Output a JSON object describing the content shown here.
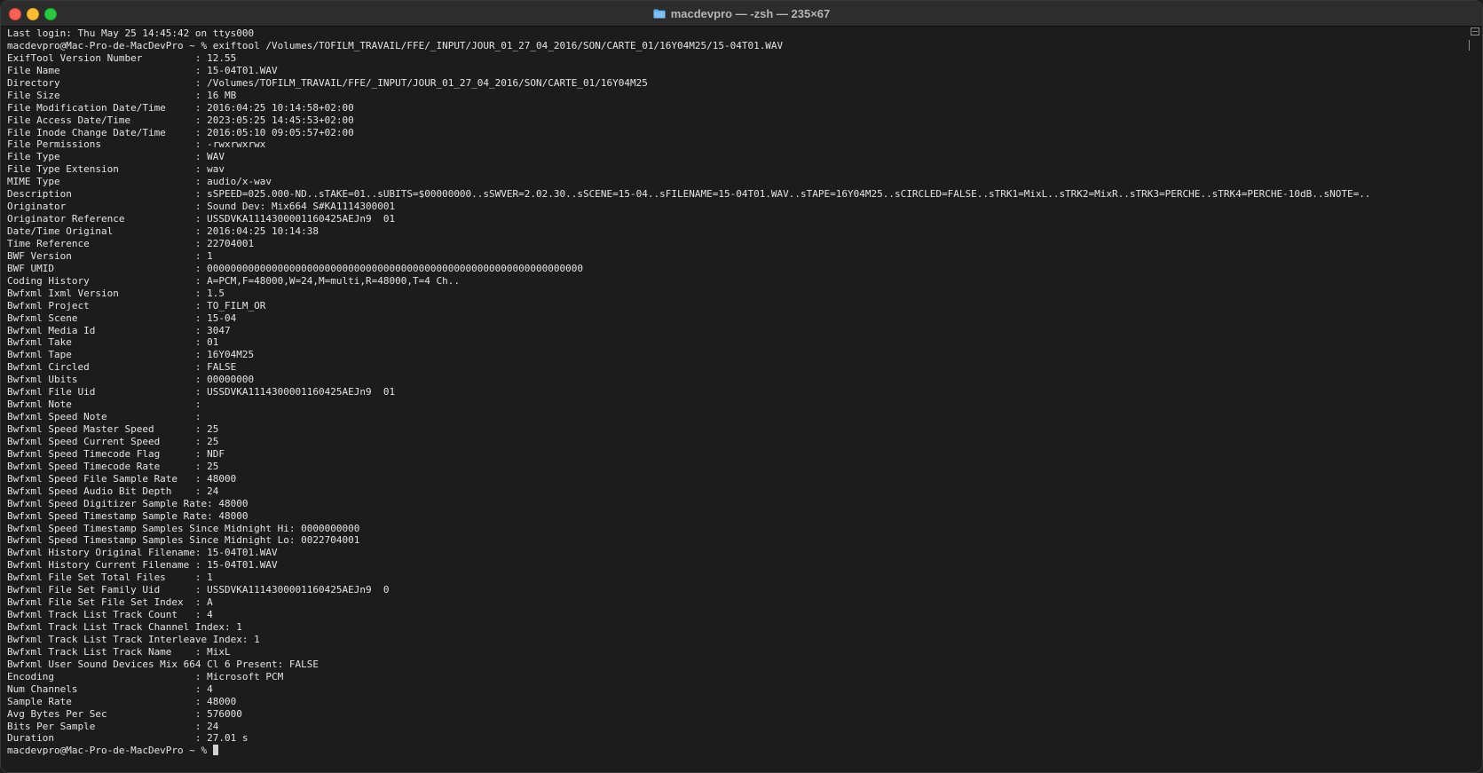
{
  "window": {
    "title": "macdevpro — -zsh — 235×67",
    "folder_icon": "folder-icon",
    "colors": {
      "close": "#fe5f57",
      "minimize": "#febc2e",
      "maximize": "#28c840",
      "background": "#1c1c1c",
      "text": "#e4e4e4"
    }
  },
  "terminal": {
    "lines": [
      "Last login: Thu May 25 14:45:42 on ttys000",
      "macdevpro@Mac-Pro-de-MacDevPro ~ % exiftool /Volumes/TOFILM_TRAVAIL/FFE/_INPUT/JOUR_01_27_04_2016/SON/CARTE_01/16Y04M25/15-04T01.WAV",
      "ExifTool Version Number         : 12.55",
      "File Name                       : 15-04T01.WAV",
      "Directory                       : /Volumes/TOFILM_TRAVAIL/FFE/_INPUT/JOUR_01_27_04_2016/SON/CARTE_01/16Y04M25",
      "File Size                       : 16 MB",
      "File Modification Date/Time     : 2016:04:25 10:14:58+02:00",
      "File Access Date/Time           : 2023:05:25 14:45:53+02:00",
      "File Inode Change Date/Time     : 2016:05:10 09:05:57+02:00",
      "File Permissions                : -rwxrwxrwx",
      "File Type                       : WAV",
      "File Type Extension             : wav",
      "MIME Type                       : audio/x-wav",
      "Description                     : sSPEED=025.000-ND..sTAKE=01..sUBITS=$00000000..sSWVER=2.02.30..sSCENE=15-04..sFILENAME=15-04T01.WAV..sTAPE=16Y04M25..sCIRCLED=FALSE..sTRK1=MixL..sTRK2=MixR..sTRK3=PERCHE..sTRK4=PERCHE-10dB..sNOTE=..",
      "Originator                      : Sound Dev: Mix664 S#KA1114300001",
      "Originator Reference            : USSDVKA1114300001160425AEJn9  01",
      "Date/Time Original              : 2016:04:25 10:14:38",
      "Time Reference                  : 22704001",
      "BWF Version                     : 1",
      "BWF UMID                        : 0000000000000000000000000000000000000000000000000000000000000000",
      "Coding History                  : A=PCM,F=48000,W=24,M=multi,R=48000,T=4 Ch..",
      "Bwfxml Ixml Version             : 1.5",
      "Bwfxml Project                  : TO_FILM_OR",
      "Bwfxml Scene                    : 15-04",
      "Bwfxml Media Id                 : 3047",
      "Bwfxml Take                     : 01",
      "Bwfxml Tape                     : 16Y04M25",
      "Bwfxml Circled                  : FALSE",
      "Bwfxml Ubits                    : 00000000",
      "Bwfxml File Uid                 : USSDVKA1114300001160425AEJn9  01",
      "Bwfxml Note                     :",
      "Bwfxml Speed Note               :",
      "Bwfxml Speed Master Speed       : 25",
      "Bwfxml Speed Current Speed      : 25",
      "Bwfxml Speed Timecode Flag      : NDF",
      "Bwfxml Speed Timecode Rate      : 25",
      "Bwfxml Speed File Sample Rate   : 48000",
      "Bwfxml Speed Audio Bit Depth    : 24",
      "Bwfxml Speed Digitizer Sample Rate: 48000",
      "Bwfxml Speed Timestamp Sample Rate: 48000",
      "Bwfxml Speed Timestamp Samples Since Midnight Hi: 0000000000",
      "Bwfxml Speed Timestamp Samples Since Midnight Lo: 0022704001",
      "Bwfxml History Original Filename: 15-04T01.WAV",
      "Bwfxml History Current Filename : 15-04T01.WAV",
      "Bwfxml File Set Total Files     : 1",
      "Bwfxml File Set Family Uid      : USSDVKA1114300001160425AEJn9  0",
      "Bwfxml File Set File Set Index  : A",
      "Bwfxml Track List Track Count   : 4",
      "Bwfxml Track List Track Channel Index: 1",
      "Bwfxml Track List Track Interleave Index: 1",
      "Bwfxml Track List Track Name    : MixL",
      "Bwfxml User Sound Devices Mix 664 Cl 6 Present: FALSE",
      "Encoding                        : Microsoft PCM",
      "Num Channels                    : 4",
      "Sample Rate                     : 48000",
      "Avg Bytes Per Sec               : 576000",
      "Bits Per Sample                 : 24",
      "Duration                        : 27.01 s"
    ],
    "prompt": "macdevpro@Mac-Pro-de-MacDevPro ~ % "
  }
}
